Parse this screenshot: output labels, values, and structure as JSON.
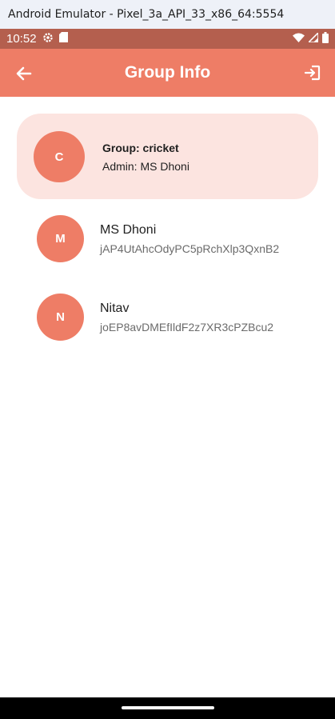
{
  "window": {
    "title": "Android Emulator - Pixel_3a_API_33_x86_64:5554"
  },
  "status_bar": {
    "time": "10:52"
  },
  "appbar": {
    "title": "Group Info",
    "back_icon": "arrow-back-icon",
    "exit_icon": "exit-icon"
  },
  "colors": {
    "primary": "#ee7d66",
    "card": "#fce4e0",
    "status_bar": "#b45f4e"
  },
  "group": {
    "avatar_letter": "C",
    "name_line": "Group: cricket",
    "admin_line": "Admin: MS Dhoni"
  },
  "members": [
    {
      "avatar_letter": "M",
      "name": "MS Dhoni",
      "uid": "jAP4UtAhcOdyPC5pRchXlp3QxnB2"
    },
    {
      "avatar_letter": "N",
      "name": "Nitav",
      "uid": "joEP8avDMEfIldF2z7XR3cPZBcu2"
    }
  ]
}
